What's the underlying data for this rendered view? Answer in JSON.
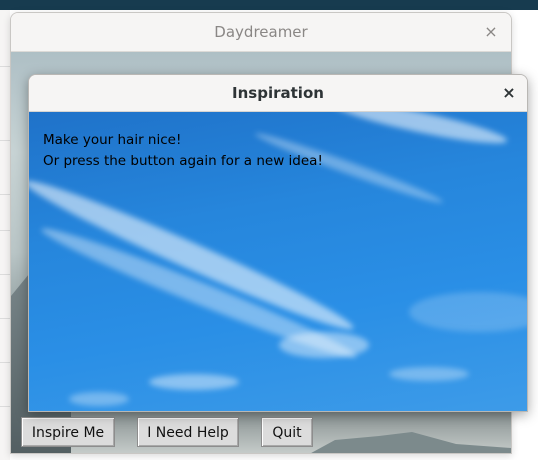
{
  "main_window": {
    "title": "Daydreamer",
    "close_glyph": "×"
  },
  "buttons": {
    "inspire": "Inspire Me",
    "help": "I Need Help",
    "quit": "Quit"
  },
  "dialog": {
    "title": "Inspiration",
    "close_glyph": "×",
    "line1": "Make your hair nice!",
    "line2": "Or press the button again for a new idea!"
  },
  "colors": {
    "sky": "#2686dc",
    "topbar": "#173b4f"
  }
}
